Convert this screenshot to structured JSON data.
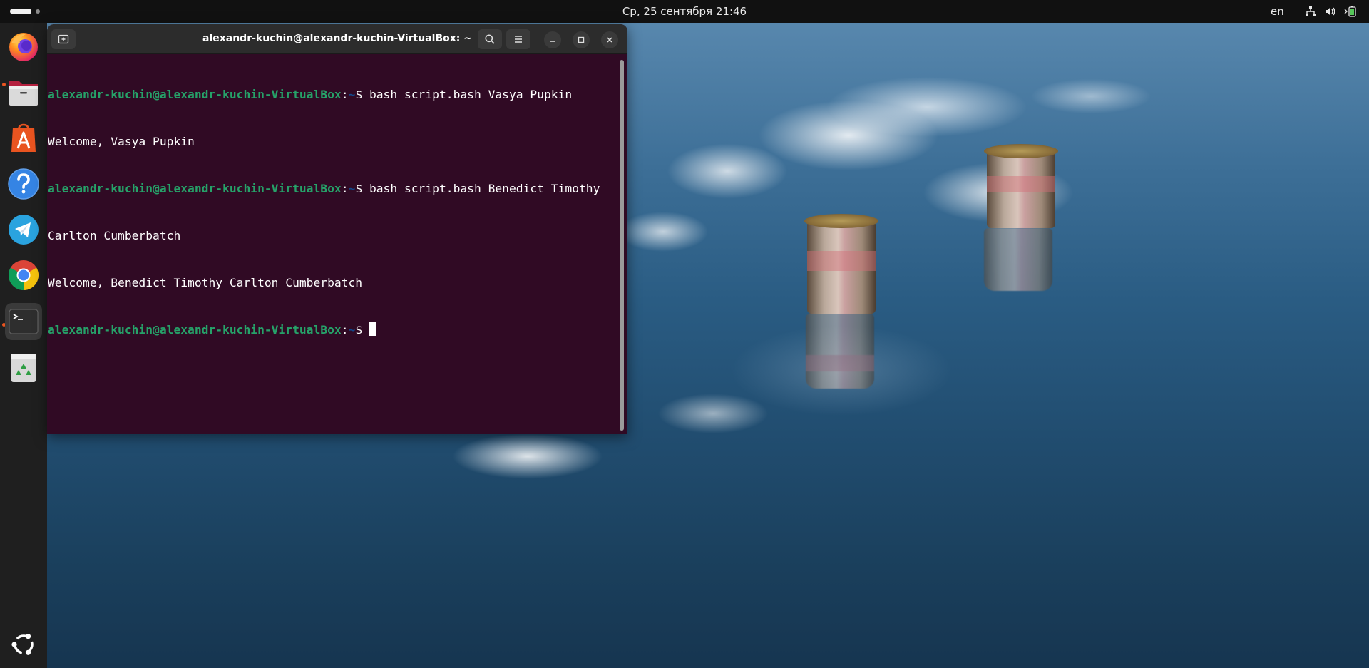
{
  "topbar": {
    "clock": "Ср, 25 сентября  21:46",
    "language": "en",
    "tray_icons": [
      "network-icon",
      "volume-icon",
      "battery-icon"
    ]
  },
  "dock": {
    "items": [
      {
        "name": "firefox-icon",
        "running": false
      },
      {
        "name": "files-icon",
        "running": true
      },
      {
        "name": "app-center-icon",
        "running": false
      },
      {
        "name": "help-icon",
        "running": false
      },
      {
        "name": "telegram-icon",
        "running": false
      },
      {
        "name": "chrome-icon",
        "running": false
      },
      {
        "name": "terminal-icon",
        "running": true,
        "active": true
      },
      {
        "name": "trash-icon",
        "running": false
      }
    ],
    "show_apps_icon": "ubuntu-logo-icon"
  },
  "terminal": {
    "title": "alexandr-kuchin@alexandr-kuchin-VirtualBox: ~",
    "prompt_user": "alexandr-kuchin@alexandr-kuchin-VirtualBox",
    "prompt_colon": ":",
    "prompt_path": "~",
    "prompt_symbol": "$ ",
    "lines": {
      "cmd1": "bash script.bash Vasya Pupkin",
      "out1": "Welcome, Vasya Pupkin",
      "cmd2a": "bash script.bash Benedict Timothy",
      "cmd2b": "Carlton Cumberbatch",
      "out2": "Welcome, Benedict Timothy Carlton Cumberbatch"
    }
  },
  "colors": {
    "terminal_bg": "#300a24",
    "prompt_user": "#26a269",
    "prompt_path": "#12488b",
    "accent": "#e95420"
  }
}
